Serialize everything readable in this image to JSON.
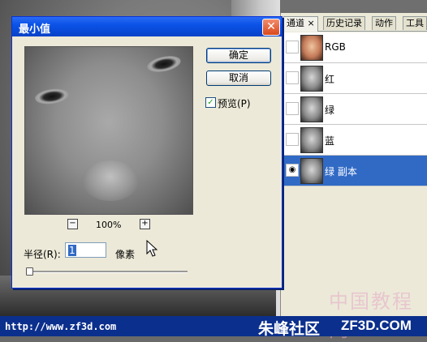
{
  "dialog": {
    "title": "最小值",
    "ok_label": "确定",
    "cancel_label": "取消",
    "preview_label": "预览(P)",
    "preview_checked": true,
    "zoom_level": "100%",
    "radius_label": "半径(R):",
    "radius_value": "1",
    "radius_unit": "像素",
    "radius_slider_fraction": 0.0
  },
  "panel": {
    "tabs": [
      "通道 ×",
      "历史记录",
      "动作",
      "工具"
    ],
    "channels": [
      {
        "name": "RGB",
        "visible": false,
        "selected": false
      },
      {
        "name": "红",
        "visible": false,
        "selected": false
      },
      {
        "name": "绿",
        "visible": false,
        "selected": false
      },
      {
        "name": "蓝",
        "visible": false,
        "selected": false
      },
      {
        "name": "绿 副本",
        "visible": true,
        "selected": true
      }
    ]
  },
  "footer": {
    "url": "http://www.zf3d.com",
    "logo": "朱峰社区",
    "site": "ZF3D.COM"
  },
  "watermark": "中国教程网",
  "colors": {
    "titlebar": "#0a52e6",
    "selection": "#316ac5",
    "footer": "#0b2f8c",
    "close_button": "#d9481b"
  }
}
